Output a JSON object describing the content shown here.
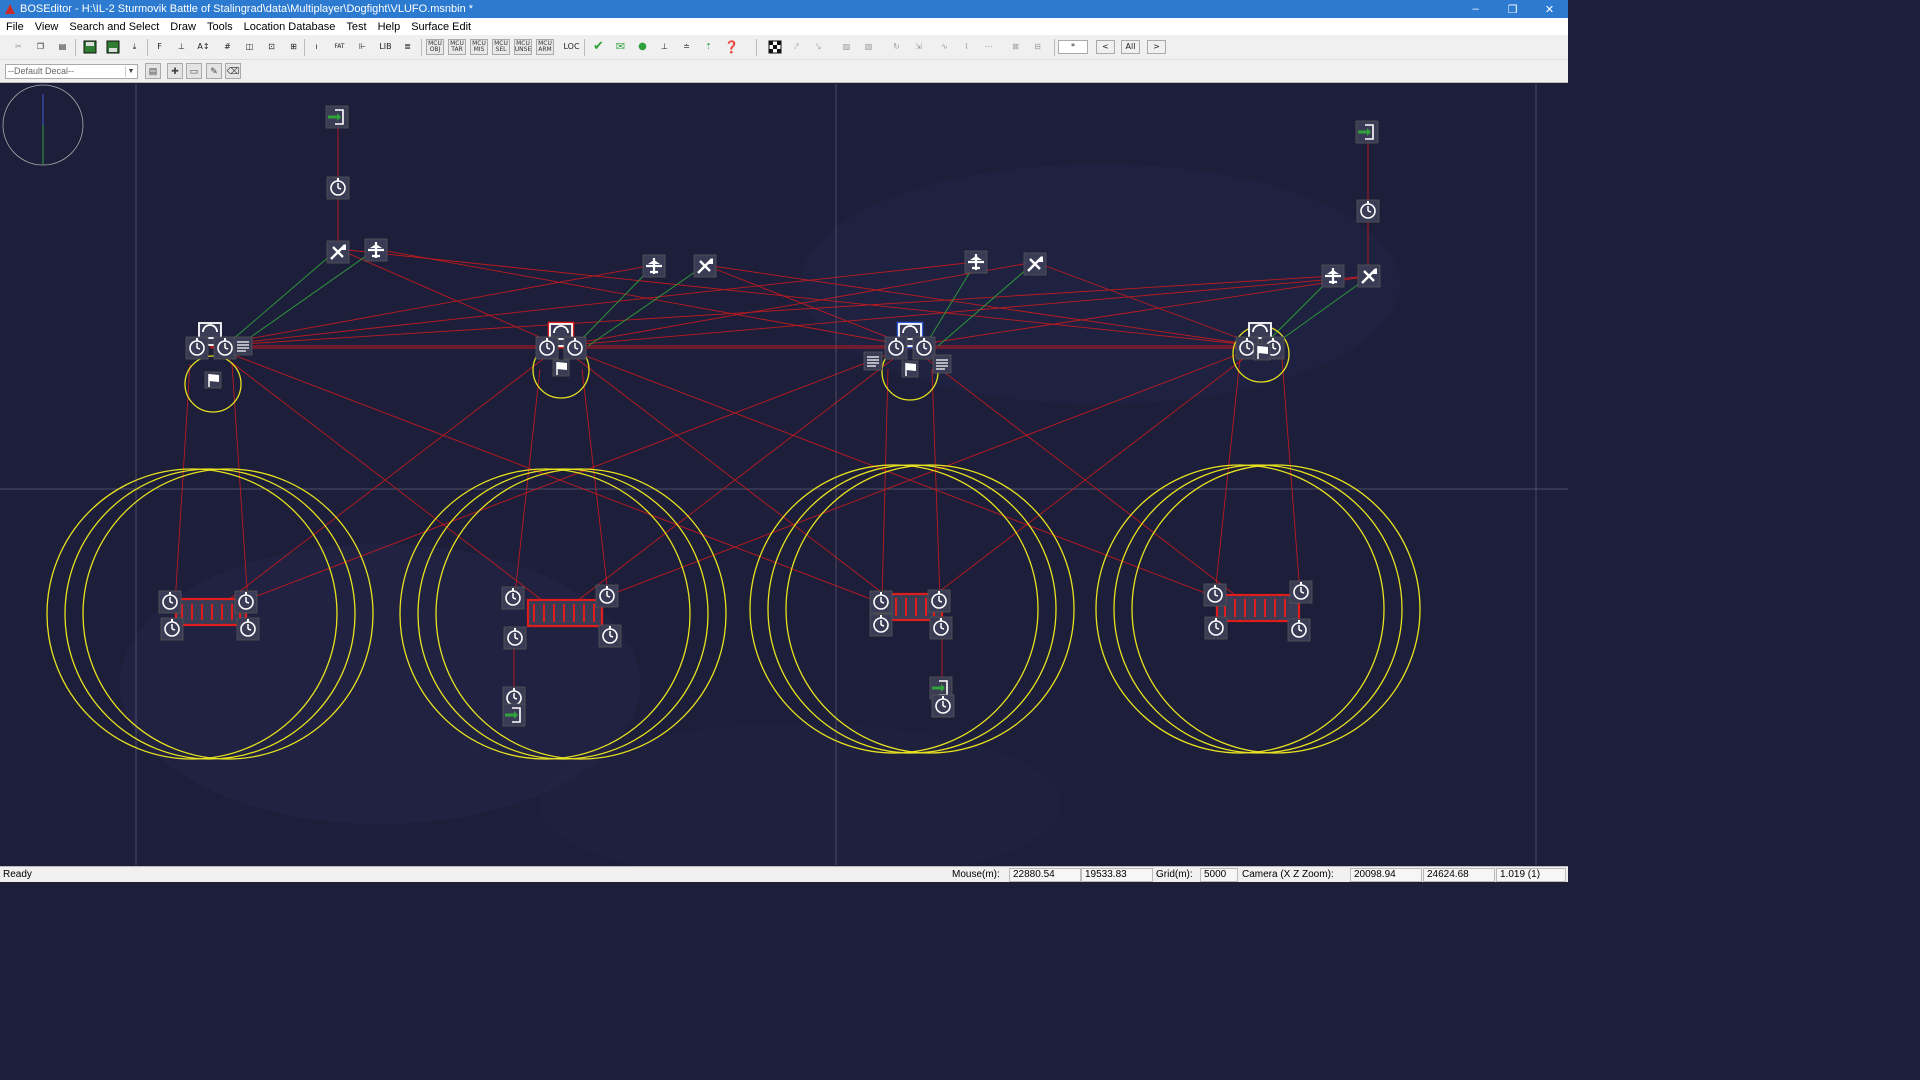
{
  "window": {
    "title": "BOSEditor - H:\\IL-2 Sturmovik Battle of Stalingrad\\data\\Multiplayer\\Dogfight\\VLUFO.msnbin *",
    "minimize": "–",
    "restore": "❐",
    "close": "✕"
  },
  "menu": [
    "File",
    "View",
    "Search and Select",
    "Draw",
    "Tools",
    "Location Database",
    "Test",
    "Help",
    "Surface Edit"
  ],
  "toolbar": {
    "mcu_buttons": [
      {
        "top": "MCU",
        "bottom": "OBJ"
      },
      {
        "top": "MCU",
        "bottom": "TAR"
      },
      {
        "top": "MCU",
        "bottom": "MIS"
      },
      {
        "top": "MCU",
        "bottom": "SEL"
      },
      {
        "top": "MCU",
        "bottom": "UNSE"
      },
      {
        "top": "MCU",
        "bottom": "ARM"
      }
    ],
    "loc_label": "LOC",
    "lib_label": "LIB",
    "fat_label": "FAT",
    "zoom_star": "*",
    "prev": "<",
    "all": "All",
    "next": ">"
  },
  "toolbar2": {
    "decal_select": "--Default Decal--"
  },
  "status": {
    "ready": "Ready",
    "mouse_label": "Mouse(m):",
    "mouse_x": "22880.54",
    "mouse_z": "19533.83",
    "grid_label": "Grid(m):",
    "grid": "5000",
    "camera_label": "Camera (X Z Zoom):",
    "camera_x": "20098.94",
    "camera_z": "24624.68",
    "camera_zoom": "1.019 (1)"
  },
  "colors": {
    "background": "#1d1e3a",
    "link_red": "#d81a1a",
    "link_green": "#2fa33a",
    "zone_yellow": "#e7e21f",
    "selected_red": "#e01c1c",
    "selected_blue": "#2c5bd8",
    "titlebar": "#2d7bd0"
  },
  "icons": {
    "app": "bos-editor-icon",
    "timer": "timer-icon",
    "plane": "plane-icon",
    "entrance": "entrance-icon",
    "flag": "flag-icon",
    "checkzone": "checkzone-icon"
  }
}
